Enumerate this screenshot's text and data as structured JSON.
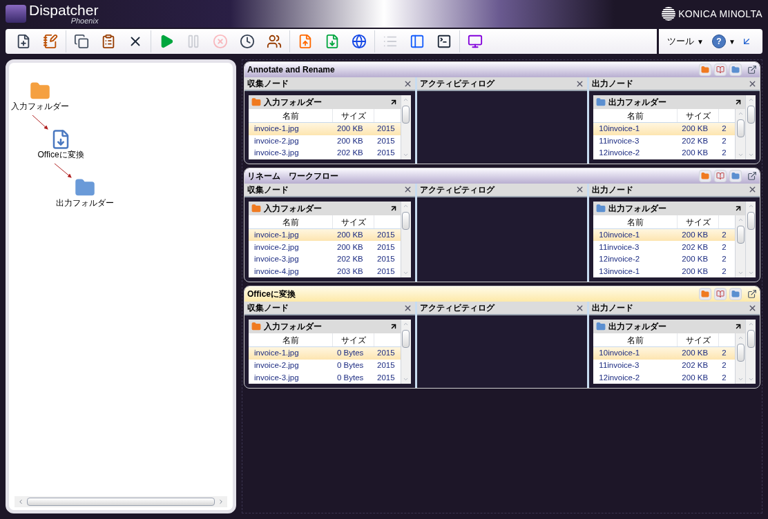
{
  "app": {
    "name": "Dispatcher",
    "subtitle": "Phoenix",
    "vendor": "KONICA MINOLTA"
  },
  "toolbar": {
    "groups": [
      [
        {
          "kind": "new",
          "disabled": false
        },
        {
          "kind": "edit",
          "disabled": false
        }
      ],
      [
        {
          "kind": "copy",
          "disabled": false
        },
        {
          "kind": "paste",
          "disabled": false
        },
        {
          "kind": "delete",
          "disabled": false
        }
      ],
      [
        {
          "kind": "run",
          "disabled": false
        },
        {
          "kind": "pause",
          "disabled": true
        },
        {
          "kind": "stop",
          "disabled": true
        },
        {
          "kind": "schedule",
          "disabled": false
        },
        {
          "kind": "users",
          "disabled": false
        }
      ],
      [
        {
          "kind": "export",
          "disabled": false
        },
        {
          "kind": "import",
          "disabled": false
        },
        {
          "kind": "web",
          "disabled": false
        }
      ],
      [
        {
          "kind": "list",
          "disabled": true
        },
        {
          "kind": "layout",
          "disabled": false
        },
        {
          "kind": "console",
          "disabled": false
        }
      ],
      [
        {
          "kind": "monitor",
          "disabled": false
        }
      ]
    ],
    "menus": [
      {
        "label": "ツール",
        "kind": "text",
        "caret": "▼"
      },
      {
        "label": "?",
        "kind": "help",
        "caret": "▼"
      }
    ]
  },
  "diagram": {
    "nodes": [
      {
        "label": "入力フォルダー",
        "kind": "input"
      },
      {
        "label": "Officeに変換",
        "kind": "convert"
      },
      {
        "label": "出力フォルダー",
        "kind": "output"
      }
    ]
  },
  "workflows": [
    {
      "title": "Annotate and Rename",
      "selected": false,
      "collect": {
        "title": "収集ノード",
        "folder": "入力フォルダー",
        "headers": [
          "名前",
          "サイズ"
        ],
        "rows": [
          {
            "name": "invoice-1.jpg",
            "size": "200 KB",
            "date": "2015",
            "selected": true
          },
          {
            "name": "invoice-2.jpg",
            "size": "200 KB",
            "date": "2015",
            "selected": false
          },
          {
            "name": "invoice-3.jpg",
            "size": "202 KB",
            "date": "2015",
            "selected": false
          }
        ]
      },
      "activity": {
        "title": "アクティビティログ"
      },
      "output": {
        "title": "出力ノード",
        "folder": "出力フォルダー",
        "headers": [
          "名前",
          "サイズ"
        ],
        "rows": [
          {
            "name": "10invoice-1",
            "size": "200 KB",
            "date": "2",
            "selected": true
          },
          {
            "name": "11invoice-3",
            "size": "202 KB",
            "date": "2",
            "selected": false
          },
          {
            "name": "12invoice-2",
            "size": "200 KB",
            "date": "2",
            "selected": false
          }
        ]
      }
    },
    {
      "title": "リネーム　ワークフロー",
      "selected": false,
      "collect": {
        "title": "収集ノード",
        "folder": "入力フォルダー",
        "headers": [
          "名前",
          "サイズ"
        ],
        "rows": [
          {
            "name": "invoice-1.jpg",
            "size": "200 KB",
            "date": "2015",
            "selected": true
          },
          {
            "name": "invoice-2.jpg",
            "size": "200 KB",
            "date": "2015",
            "selected": false
          },
          {
            "name": "invoice-3.jpg",
            "size": "202 KB",
            "date": "2015",
            "selected": false
          },
          {
            "name": "invoice-4.jpg",
            "size": "203 KB",
            "date": "2015",
            "selected": false
          }
        ]
      },
      "activity": {
        "title": "アクティビティログ"
      },
      "output": {
        "title": "出力ノード",
        "folder": "出力フォルダー",
        "headers": [
          "名前",
          "サイズ"
        ],
        "rows": [
          {
            "name": "10invoice-1",
            "size": "200 KB",
            "date": "2",
            "selected": true
          },
          {
            "name": "11invoice-3",
            "size": "202 KB",
            "date": "2",
            "selected": false
          },
          {
            "name": "12invoice-2",
            "size": "200 KB",
            "date": "2",
            "selected": false
          },
          {
            "name": "13invoice-1",
            "size": "200 KB",
            "date": "2",
            "selected": false
          }
        ]
      }
    },
    {
      "title": "Officeに変換",
      "selected": true,
      "collect": {
        "title": "収集ノード",
        "folder": "入力フォルダー",
        "headers": [
          "名前",
          "サイズ"
        ],
        "rows": [
          {
            "name": "invoice-1.jpg",
            "size": "0 Bytes",
            "date": "2015",
            "selected": true
          },
          {
            "name": "invoice-2.jpg",
            "size": "0 Bytes",
            "date": "2015",
            "selected": false
          },
          {
            "name": "invoice-3.jpg",
            "size": "0 Bytes",
            "date": "2015",
            "selected": false
          }
        ]
      },
      "activity": {
        "title": "アクティビティログ"
      },
      "output": {
        "title": "出力ノード",
        "folder": "出力フォルダー",
        "headers": [
          "名前",
          "サイズ"
        ],
        "rows": [
          {
            "name": "10invoice-1",
            "size": "200 KB",
            "date": "2",
            "selected": true
          },
          {
            "name": "11invoice-3",
            "size": "202 KB",
            "date": "2",
            "selected": false
          },
          {
            "name": "12invoice-2",
            "size": "200 KB",
            "date": "2",
            "selected": false
          }
        ]
      }
    }
  ]
}
